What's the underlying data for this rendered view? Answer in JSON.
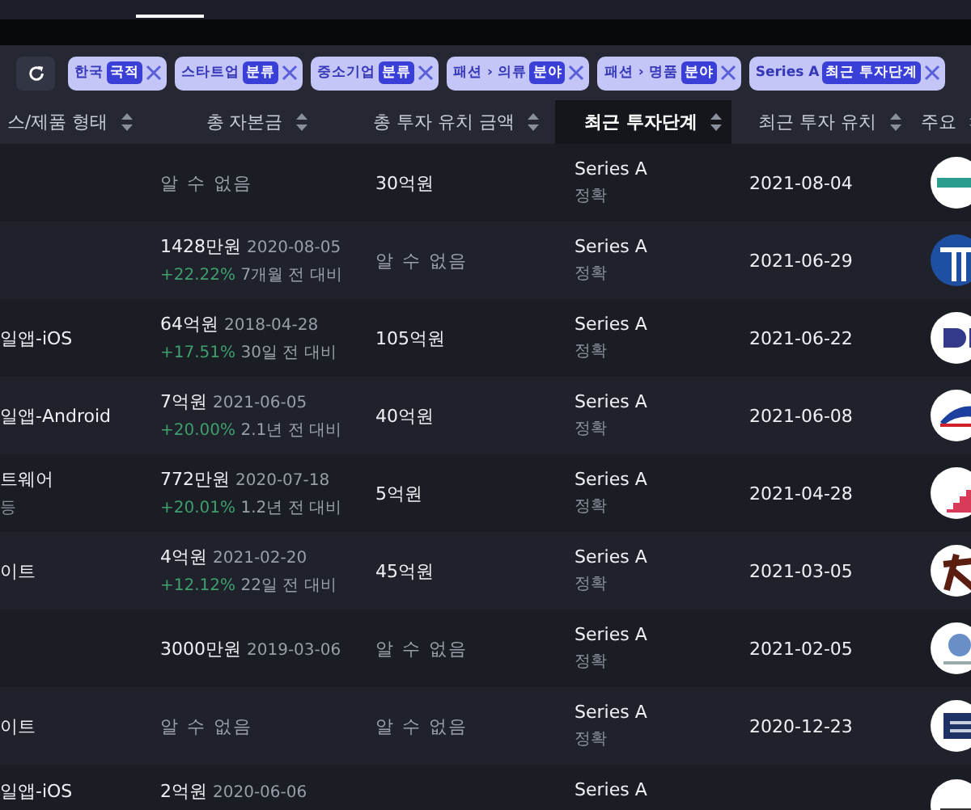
{
  "filters": [
    {
      "label": "한국",
      "category": "국적"
    },
    {
      "label": "스타트업",
      "category": "분류"
    },
    {
      "label": "중소기업",
      "category": "분류"
    },
    {
      "label": "패션 › 의류",
      "category": "분야"
    },
    {
      "label": "패션 › 명품",
      "category": "분야"
    },
    {
      "label": "Series A",
      "category": "최근 투자단계"
    }
  ],
  "table": {
    "columns": [
      {
        "label": "스/제품 형태",
        "sorted": false
      },
      {
        "label": "총 자본금",
        "sorted": false
      },
      {
        "label": "총 투자 유치 금액",
        "sorted": false
      },
      {
        "label": "최근 투자단계",
        "sorted": true
      },
      {
        "label": "최근 투자 유치",
        "sorted": false
      },
      {
        "label": "주요",
        "sorted": false
      }
    ],
    "rows": [
      {
        "capital": {
          "kind": "unknown",
          "amount": "알 수 없음"
        },
        "funding": {
          "kind": "value",
          "text": "30억원"
        },
        "stage": "Series A",
        "accuracy": "정확",
        "date": "2021-08-04"
      },
      {
        "capital": {
          "kind": "value",
          "amount": "1428만원",
          "date": "2020-08-05",
          "change": "+22.22%",
          "compare": "7개월 전 대비"
        },
        "funding": {
          "kind": "unknown",
          "text": "알 수 없음"
        },
        "stage": "Series A",
        "accuracy": "정확",
        "date": "2021-06-29"
      },
      {
        "type": {
          "text": "일앱-iOS"
        },
        "capital": {
          "kind": "value",
          "amount": "64억원",
          "date": "2018-04-28",
          "change": "+17.51%",
          "compare": "30일 전 대비"
        },
        "funding": {
          "kind": "value",
          "text": "105억원"
        },
        "stage": "Series A",
        "accuracy": "정확",
        "date": "2021-06-22"
      },
      {
        "type": {
          "text": "일앱-Android"
        },
        "capital": {
          "kind": "value",
          "amount": "7억원",
          "date": "2021-06-05",
          "change": "+20.00%",
          "compare": "2.1년 전 대비"
        },
        "funding": {
          "kind": "value",
          "text": "40억원"
        },
        "stage": "Series A",
        "accuracy": "정확",
        "date": "2021-06-08"
      },
      {
        "type": {
          "text": "트웨어",
          "sub": "등"
        },
        "capital": {
          "kind": "value",
          "amount": "772만원",
          "date": "2020-07-18",
          "change": "+20.01%",
          "compare": "1.2년 전 대비"
        },
        "funding": {
          "kind": "value",
          "text": "5억원"
        },
        "stage": "Series A",
        "accuracy": "정확",
        "date": "2021-04-28"
      },
      {
        "type": {
          "text": "이트"
        },
        "capital": {
          "kind": "value",
          "amount": "4억원",
          "date": "2021-02-20",
          "change": "+12.12%",
          "compare": "22일 전 대비"
        },
        "funding": {
          "kind": "value",
          "text": "45억원"
        },
        "stage": "Series A",
        "accuracy": "정확",
        "date": "2021-03-05"
      },
      {
        "capital": {
          "kind": "value",
          "amount": "3000만원",
          "date": "2019-03-06"
        },
        "funding": {
          "kind": "unknown",
          "text": "알 수 없음"
        },
        "stage": "Series A",
        "accuracy": "정확",
        "date": "2021-02-05"
      },
      {
        "type": {
          "text": "이트"
        },
        "capital": {
          "kind": "unknown",
          "amount": "알 수 없음"
        },
        "funding": {
          "kind": "unknown",
          "text": "알 수 없음"
        },
        "stage": "Series A",
        "accuracy": "정확",
        "date": "2020-12-23"
      },
      {
        "type": {
          "text": "일앱-iOS"
        },
        "capital": {
          "kind": "value",
          "amount": "2억원",
          "date": "2020-06-06"
        },
        "stage": "Series A"
      }
    ]
  }
}
